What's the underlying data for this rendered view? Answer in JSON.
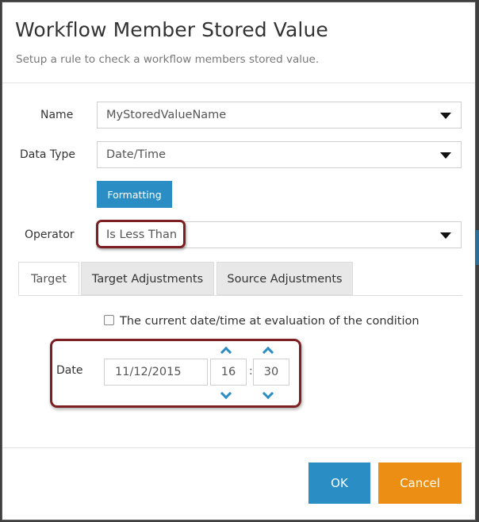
{
  "dialog": {
    "title": "Workflow Member Stored Value",
    "subtitle": "Setup a rule to check a workflow members stored value."
  },
  "form": {
    "name_label": "Name",
    "name_value": "MyStoredValueName",
    "datatype_label": "Data Type",
    "datatype_value": "Date/Time",
    "formatting_label": "Formatting",
    "operator_label": "Operator",
    "operator_value": "Is Less Than"
  },
  "tabs": [
    {
      "label": "Target",
      "active": true
    },
    {
      "label": "Target Adjustments",
      "active": false
    },
    {
      "label": "Source Adjustments",
      "active": false
    }
  ],
  "target": {
    "checkbox_label": "The current date/time at evaluation of the condition",
    "checkbox_checked": false,
    "date_label": "Date",
    "date_value": "11/12/2015",
    "hour_value": "16",
    "separator": ":",
    "minute_value": "30"
  },
  "footer": {
    "ok_label": "OK",
    "cancel_label": "Cancel"
  },
  "colors": {
    "primary": "#2a8ec4",
    "cancel": "#ec8e14",
    "highlight": "#7d1f22"
  }
}
